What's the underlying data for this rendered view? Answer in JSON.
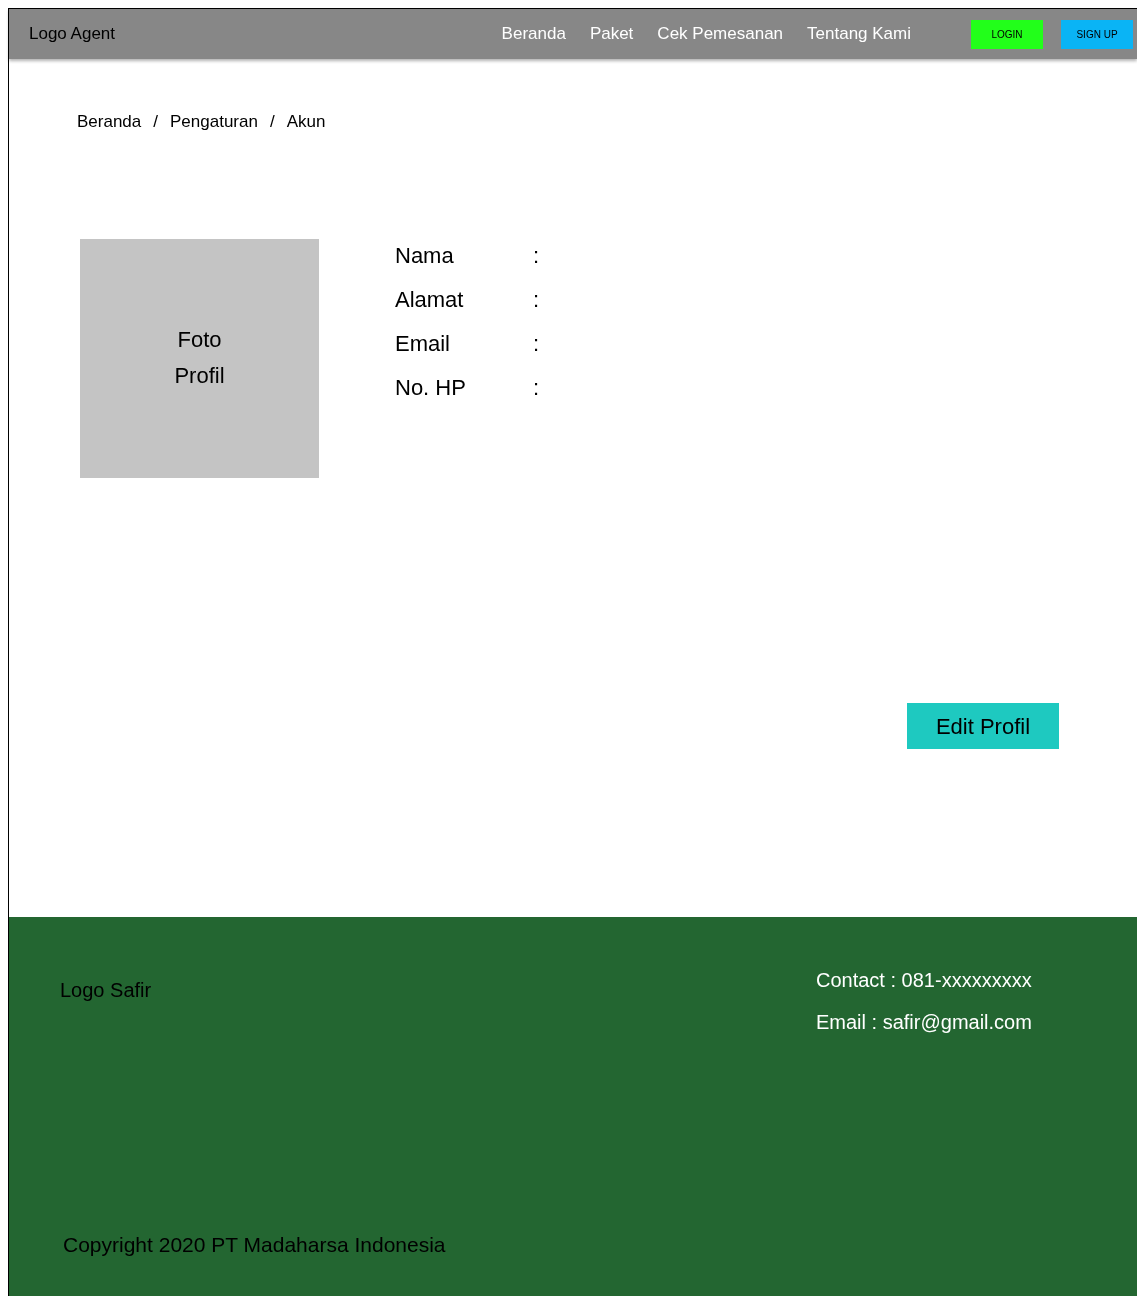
{
  "header": {
    "logo": "Logo Agent",
    "nav": [
      "Beranda",
      "Paket",
      "Cek Pemesanan",
      "Tentang Kami"
    ],
    "login": "LOGIN",
    "signup": "SIGN UP"
  },
  "breadcrumb": {
    "items": [
      "Beranda",
      "Pengaturan",
      "Akun"
    ],
    "separators": [
      "/",
      "/"
    ]
  },
  "profile": {
    "photo": "Foto\nProfil",
    "fields": [
      {
        "label": "Nama",
        "colon": ":"
      },
      {
        "label": "Alamat",
        "colon": ":"
      },
      {
        "label": "Email",
        "colon": ":"
      },
      {
        "label": "No. HP",
        "colon": ":"
      }
    ]
  },
  "edit_button": "Edit Profil",
  "footer": {
    "logo": "Logo Safir",
    "contact": "Contact : 081-xxxxxxxxx",
    "email": "Email : safir@gmail.com",
    "copyright": "Copyright 2020 PT Madaharsa Indonesia"
  }
}
